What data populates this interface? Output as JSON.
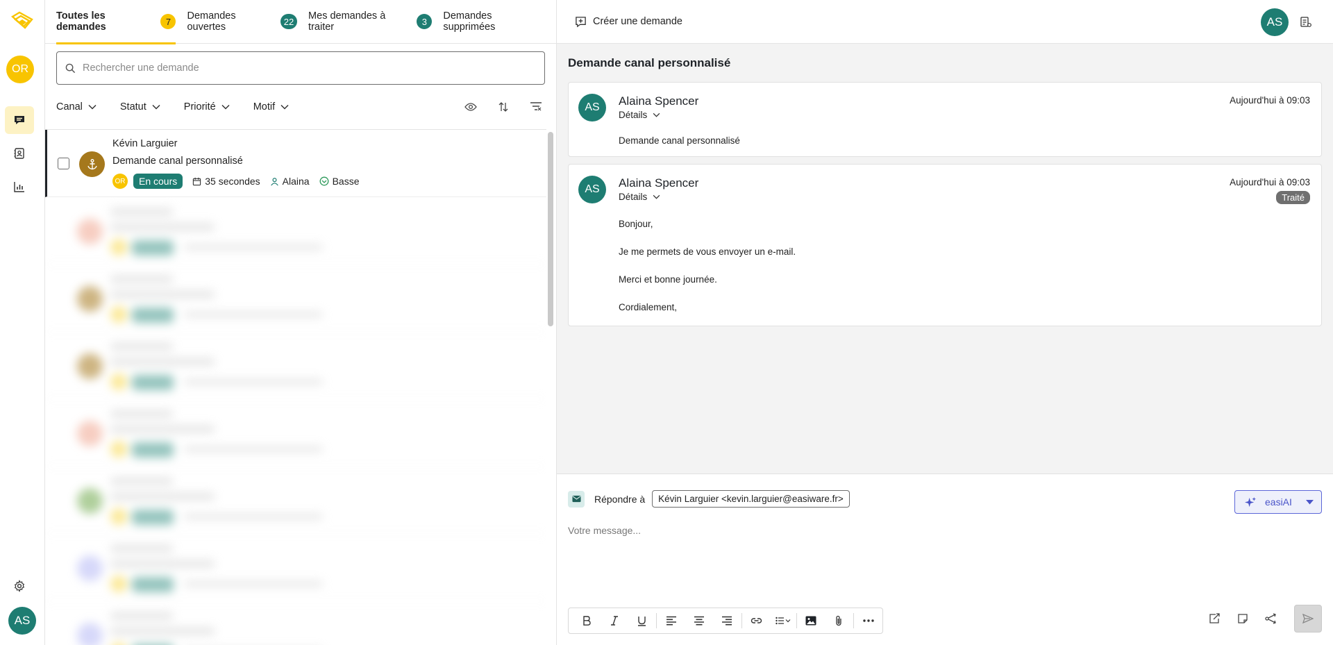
{
  "app": {
    "user_initials": "AS",
    "org_initials": "OR"
  },
  "colors": {
    "accent_yellow": "#f8c400",
    "teal": "#1e7d72",
    "ai_blue": "#5b66d8"
  },
  "rail": {
    "items": [
      {
        "name": "conversations",
        "icon": "chat-icon",
        "active": true
      },
      {
        "name": "contacts",
        "icon": "contact-book-icon",
        "active": false
      },
      {
        "name": "statistics",
        "icon": "bar-chart-icon",
        "active": false
      },
      {
        "name": "settings",
        "icon": "gear-icon",
        "active": false
      }
    ]
  },
  "tabs": [
    {
      "label": "Toutes les demandes",
      "count": "7",
      "active": true
    },
    {
      "label": "Demandes ouvertes",
      "count": "22"
    },
    {
      "label": "Mes demandes à traiter",
      "count": "3"
    },
    {
      "label": "Demandes supprimées"
    }
  ],
  "search": {
    "placeholder": "Rechercher une demande"
  },
  "filters": {
    "channel": "Canal",
    "status": "Statut",
    "priority": "Priorité",
    "reason": "Motif"
  },
  "requests": [
    {
      "name": "Kévin Larguier",
      "subject": "Demande canal personnalisé",
      "team": "OR",
      "status": "En cours",
      "duration": "35 secondes",
      "assignee": "Alaina",
      "priority": "Basse"
    }
  ],
  "header": {
    "create_label": "Créer une demande"
  },
  "conversation": {
    "title": "Demande canal personnalisé",
    "messages": [
      {
        "initials": "AS",
        "author": "Alaina Spencer",
        "details": "Détails",
        "date": "Aujourd'hui à 09:03",
        "lines": [
          "Demande canal personnalisé"
        ]
      },
      {
        "initials": "AS",
        "author": "Alaina Spencer",
        "details": "Détails",
        "date": "Aujourd'hui à 09:03",
        "badge": "Traité",
        "lines": [
          "Bonjour,",
          "Je me permets de vous envoyer un e-mail.",
          "Merci et bonne journée.",
          "Cordialement,"
        ]
      }
    ]
  },
  "composer": {
    "reply_label": "Répondre à",
    "reply_to": "Kévin Larguier <kevin.larguier@easiware.fr>",
    "ai_label": "easiAI",
    "placeholder": "Votre message..."
  }
}
